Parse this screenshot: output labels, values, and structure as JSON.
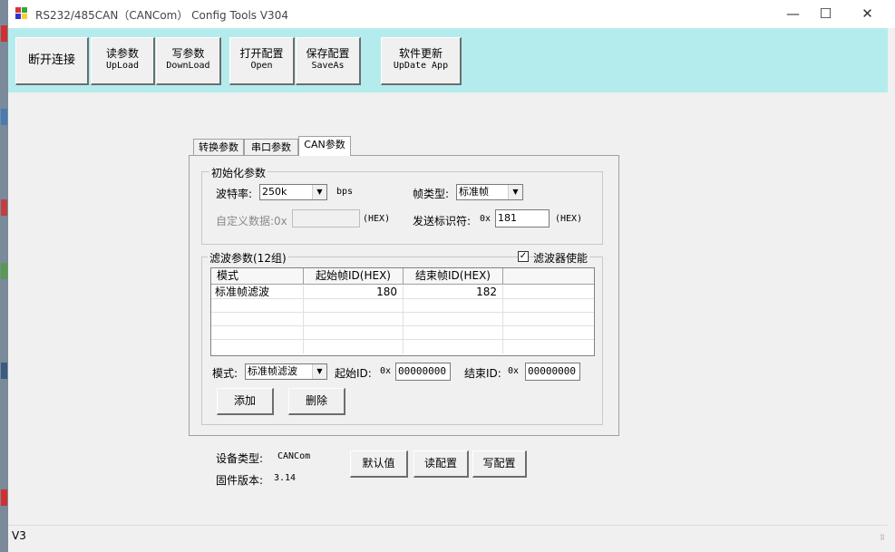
{
  "window": {
    "title": "RS232/485CAN（CANCom） Config Tools V304",
    "minimize": "—",
    "maximize": "☐",
    "close": "✕"
  },
  "toolbar": {
    "disconnect": "断开连接",
    "read": {
      "cn": "读参数",
      "en": "UpLoad"
    },
    "write": {
      "cn": "写参数",
      "en": "DownLoad"
    },
    "open": {
      "cn": "打开配置",
      "en": "Open"
    },
    "save": {
      "cn": "保存配置",
      "en": "SaveAs"
    },
    "update": {
      "cn": "软件更新",
      "en": "UpDate App"
    }
  },
  "tabs": [
    "转换参数",
    "串口参数",
    "CAN参数"
  ],
  "init_group": {
    "title": "初始化参数",
    "baud_label": "波特率:",
    "baud_value": "250k",
    "baud_unit": "bps",
    "frame_type_label": "帧类型:",
    "frame_type_value": "标准帧",
    "custom_label": "自定义数据:0x",
    "custom_value": "",
    "custom_hex": "(HEX)",
    "send_id_label": "发送标识符:",
    "send_id_prefix": "0x",
    "send_id_value": "181",
    "send_id_hex": "(HEX)"
  },
  "filter_group": {
    "title": "滤波参数(12组)",
    "enable_label": "滤波器使能",
    "enable_checked": "✓",
    "columns": [
      "模式",
      "起始帧ID(HEX)",
      "结束帧ID(HEX)"
    ],
    "rows": [
      [
        "标准帧滤波",
        "180",
        "182"
      ]
    ],
    "mode_label": "模式:",
    "mode_value": "标准帧滤波",
    "start_label": "起始ID:",
    "start_prefix": "0x",
    "start_value": "00000000",
    "end_label": "结束ID:",
    "end_prefix": "0x",
    "end_value": "00000000",
    "add": "添加",
    "delete": "删除"
  },
  "device": {
    "type_label": "设备类型:",
    "type_value": "CANCom",
    "fw_label": "固件版本:",
    "fw_value": "3.14"
  },
  "actions": {
    "default": "默认值",
    "read": "读配置",
    "write": "写配置"
  },
  "status": {
    "text": "V3"
  },
  "colors": {
    "toolbar_bg": "#b4ecee",
    "window_bg": "#f0f0f0"
  },
  "icons": {
    "combo_arrow": "▼",
    "grip": "⠿"
  }
}
